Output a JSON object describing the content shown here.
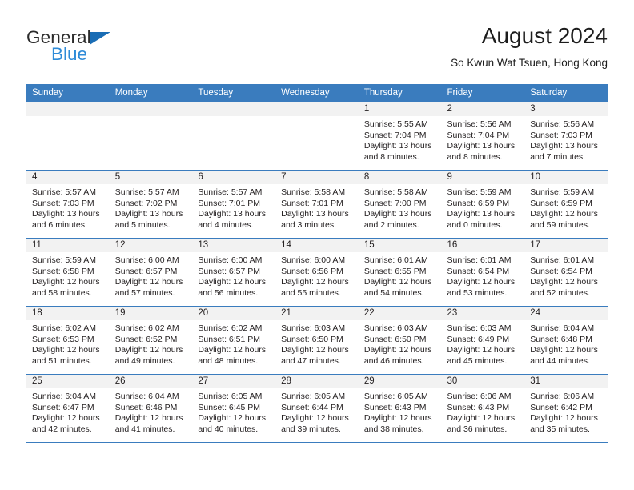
{
  "brand": {
    "name_part1": "General",
    "name_part2": "Blue",
    "triangle_color": "#1a6db5",
    "blue_color": "#2e8bd8"
  },
  "header": {
    "title": "August 2024",
    "subtitle": "So Kwun Wat Tsuen, Hong Kong"
  },
  "theme": {
    "header_bg": "#3a7cbe",
    "daynum_bg": "#f2f2f2",
    "text": "#231f20"
  },
  "weekdays": [
    "Sunday",
    "Monday",
    "Tuesday",
    "Wednesday",
    "Thursday",
    "Friday",
    "Saturday"
  ],
  "weeks": [
    [
      {
        "day": "",
        "sunrise": "",
        "sunset": "",
        "daylight": ""
      },
      {
        "day": "",
        "sunrise": "",
        "sunset": "",
        "daylight": ""
      },
      {
        "day": "",
        "sunrise": "",
        "sunset": "",
        "daylight": ""
      },
      {
        "day": "",
        "sunrise": "",
        "sunset": "",
        "daylight": ""
      },
      {
        "day": "1",
        "sunrise": "Sunrise: 5:55 AM",
        "sunset": "Sunset: 7:04 PM",
        "daylight": "Daylight: 13 hours and 8 minutes."
      },
      {
        "day": "2",
        "sunrise": "Sunrise: 5:56 AM",
        "sunset": "Sunset: 7:04 PM",
        "daylight": "Daylight: 13 hours and 8 minutes."
      },
      {
        "day": "3",
        "sunrise": "Sunrise: 5:56 AM",
        "sunset": "Sunset: 7:03 PM",
        "daylight": "Daylight: 13 hours and 7 minutes."
      }
    ],
    [
      {
        "day": "4",
        "sunrise": "Sunrise: 5:57 AM",
        "sunset": "Sunset: 7:03 PM",
        "daylight": "Daylight: 13 hours and 6 minutes."
      },
      {
        "day": "5",
        "sunrise": "Sunrise: 5:57 AM",
        "sunset": "Sunset: 7:02 PM",
        "daylight": "Daylight: 13 hours and 5 minutes."
      },
      {
        "day": "6",
        "sunrise": "Sunrise: 5:57 AM",
        "sunset": "Sunset: 7:01 PM",
        "daylight": "Daylight: 13 hours and 4 minutes."
      },
      {
        "day": "7",
        "sunrise": "Sunrise: 5:58 AM",
        "sunset": "Sunset: 7:01 PM",
        "daylight": "Daylight: 13 hours and 3 minutes."
      },
      {
        "day": "8",
        "sunrise": "Sunrise: 5:58 AM",
        "sunset": "Sunset: 7:00 PM",
        "daylight": "Daylight: 13 hours and 2 minutes."
      },
      {
        "day": "9",
        "sunrise": "Sunrise: 5:59 AM",
        "sunset": "Sunset: 6:59 PM",
        "daylight": "Daylight: 13 hours and 0 minutes."
      },
      {
        "day": "10",
        "sunrise": "Sunrise: 5:59 AM",
        "sunset": "Sunset: 6:59 PM",
        "daylight": "Daylight: 12 hours and 59 minutes."
      }
    ],
    [
      {
        "day": "11",
        "sunrise": "Sunrise: 5:59 AM",
        "sunset": "Sunset: 6:58 PM",
        "daylight": "Daylight: 12 hours and 58 minutes."
      },
      {
        "day": "12",
        "sunrise": "Sunrise: 6:00 AM",
        "sunset": "Sunset: 6:57 PM",
        "daylight": "Daylight: 12 hours and 57 minutes."
      },
      {
        "day": "13",
        "sunrise": "Sunrise: 6:00 AM",
        "sunset": "Sunset: 6:57 PM",
        "daylight": "Daylight: 12 hours and 56 minutes."
      },
      {
        "day": "14",
        "sunrise": "Sunrise: 6:00 AM",
        "sunset": "Sunset: 6:56 PM",
        "daylight": "Daylight: 12 hours and 55 minutes."
      },
      {
        "day": "15",
        "sunrise": "Sunrise: 6:01 AM",
        "sunset": "Sunset: 6:55 PM",
        "daylight": "Daylight: 12 hours and 54 minutes."
      },
      {
        "day": "16",
        "sunrise": "Sunrise: 6:01 AM",
        "sunset": "Sunset: 6:54 PM",
        "daylight": "Daylight: 12 hours and 53 minutes."
      },
      {
        "day": "17",
        "sunrise": "Sunrise: 6:01 AM",
        "sunset": "Sunset: 6:54 PM",
        "daylight": "Daylight: 12 hours and 52 minutes."
      }
    ],
    [
      {
        "day": "18",
        "sunrise": "Sunrise: 6:02 AM",
        "sunset": "Sunset: 6:53 PM",
        "daylight": "Daylight: 12 hours and 51 minutes."
      },
      {
        "day": "19",
        "sunrise": "Sunrise: 6:02 AM",
        "sunset": "Sunset: 6:52 PM",
        "daylight": "Daylight: 12 hours and 49 minutes."
      },
      {
        "day": "20",
        "sunrise": "Sunrise: 6:02 AM",
        "sunset": "Sunset: 6:51 PM",
        "daylight": "Daylight: 12 hours and 48 minutes."
      },
      {
        "day": "21",
        "sunrise": "Sunrise: 6:03 AM",
        "sunset": "Sunset: 6:50 PM",
        "daylight": "Daylight: 12 hours and 47 minutes."
      },
      {
        "day": "22",
        "sunrise": "Sunrise: 6:03 AM",
        "sunset": "Sunset: 6:50 PM",
        "daylight": "Daylight: 12 hours and 46 minutes."
      },
      {
        "day": "23",
        "sunrise": "Sunrise: 6:03 AM",
        "sunset": "Sunset: 6:49 PM",
        "daylight": "Daylight: 12 hours and 45 minutes."
      },
      {
        "day": "24",
        "sunrise": "Sunrise: 6:04 AM",
        "sunset": "Sunset: 6:48 PM",
        "daylight": "Daylight: 12 hours and 44 minutes."
      }
    ],
    [
      {
        "day": "25",
        "sunrise": "Sunrise: 6:04 AM",
        "sunset": "Sunset: 6:47 PM",
        "daylight": "Daylight: 12 hours and 42 minutes."
      },
      {
        "day": "26",
        "sunrise": "Sunrise: 6:04 AM",
        "sunset": "Sunset: 6:46 PM",
        "daylight": "Daylight: 12 hours and 41 minutes."
      },
      {
        "day": "27",
        "sunrise": "Sunrise: 6:05 AM",
        "sunset": "Sunset: 6:45 PM",
        "daylight": "Daylight: 12 hours and 40 minutes."
      },
      {
        "day": "28",
        "sunrise": "Sunrise: 6:05 AM",
        "sunset": "Sunset: 6:44 PM",
        "daylight": "Daylight: 12 hours and 39 minutes."
      },
      {
        "day": "29",
        "sunrise": "Sunrise: 6:05 AM",
        "sunset": "Sunset: 6:43 PM",
        "daylight": "Daylight: 12 hours and 38 minutes."
      },
      {
        "day": "30",
        "sunrise": "Sunrise: 6:06 AM",
        "sunset": "Sunset: 6:43 PM",
        "daylight": "Daylight: 12 hours and 36 minutes."
      },
      {
        "day": "31",
        "sunrise": "Sunrise: 6:06 AM",
        "sunset": "Sunset: 6:42 PM",
        "daylight": "Daylight: 12 hours and 35 minutes."
      }
    ]
  ]
}
